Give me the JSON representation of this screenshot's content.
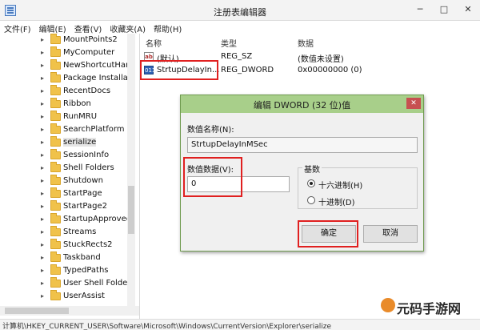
{
  "window": {
    "title": "注册表编辑器"
  },
  "menu": [
    "文件(F)",
    "编辑(E)",
    "查看(V)",
    "收藏夹(A)",
    "帮助(H)"
  ],
  "tree": {
    "items": [
      {
        "label": "MountPoints2"
      },
      {
        "label": "MyComputer"
      },
      {
        "label": "NewShortcutHan"
      },
      {
        "label": "Package Installat"
      },
      {
        "label": "RecentDocs"
      },
      {
        "label": "Ribbon"
      },
      {
        "label": "RunMRU"
      },
      {
        "label": "SearchPlatform"
      },
      {
        "label": "serialize",
        "selected": true
      },
      {
        "label": "SessionInfo"
      },
      {
        "label": "Shell Folders"
      },
      {
        "label": "Shutdown"
      },
      {
        "label": "StartPage"
      },
      {
        "label": "StartPage2"
      },
      {
        "label": "StartupApproved"
      },
      {
        "label": "Streams"
      },
      {
        "label": "StuckRects2"
      },
      {
        "label": "Taskband"
      },
      {
        "label": "TypedPaths"
      },
      {
        "label": "User Shell Folder"
      },
      {
        "label": "UserAssist"
      }
    ]
  },
  "list": {
    "columns": [
      "名称",
      "类型",
      "数据"
    ],
    "rows": [
      {
        "icon": "ab",
        "name": "(默认)",
        "type": "REG_SZ",
        "data": "(数值未设置)"
      },
      {
        "icon": "011",
        "name": "StrtupDelayIn...",
        "type": "REG_DWORD",
        "data": "0x00000000 (0)"
      }
    ]
  },
  "dialog": {
    "title": "编辑 DWORD (32 位)值",
    "close": "✕",
    "name_label": "数值名称(N):",
    "name_value": "StrtupDelayInMSec",
    "data_label": "数值数据(V):",
    "data_value": "0",
    "base_label": "基数",
    "radio_hex": "十六进制(H)",
    "radio_dec": "十进制(D)",
    "ok": "确定",
    "cancel": "取消"
  },
  "status": "计算机\\HKEY_CURRENT_USER\\Software\\Microsoft\\Windows\\CurrentVersion\\Explorer\\serialize",
  "watermark": "元码手游网",
  "colors": {
    "highlight": "#e02020",
    "dialog_title": "#a8cf8a"
  }
}
